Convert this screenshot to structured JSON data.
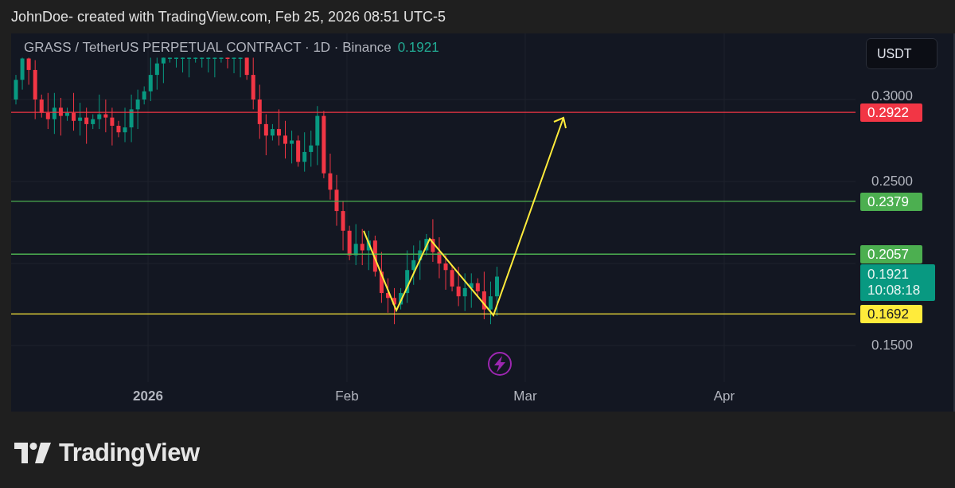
{
  "header": {
    "text": "JohnDoe- created with TradingView.com, Feb 25, 2026 08:51 UTC-5"
  },
  "legend": {
    "symbol": "GRASS / TetherUS PERPETUAL CONTRACT · 1D · Binance",
    "price": "0.1921"
  },
  "currency_button": {
    "label": "USDT"
  },
  "price_axis": {
    "ticks": [
      "0.3000",
      "0.2500",
      "0.1500"
    ]
  },
  "price_lines": [
    {
      "label": "0.2922",
      "color": "#f23645"
    },
    {
      "label": "0.2379",
      "color": "#4caf50"
    },
    {
      "label": "0.2057",
      "color": "#4caf50"
    },
    {
      "label": "0.1692",
      "color": "#ffeb3b"
    }
  ],
  "current_price": {
    "price": "0.1921",
    "countdown": "10:08:18"
  },
  "time_axis": [
    {
      "label": "2026",
      "bold": true
    },
    {
      "label": "Feb",
      "bold": false
    },
    {
      "label": "Mar",
      "bold": false
    },
    {
      "label": "Apr",
      "bold": false
    }
  ],
  "brand": {
    "name": "TradingView"
  }
}
